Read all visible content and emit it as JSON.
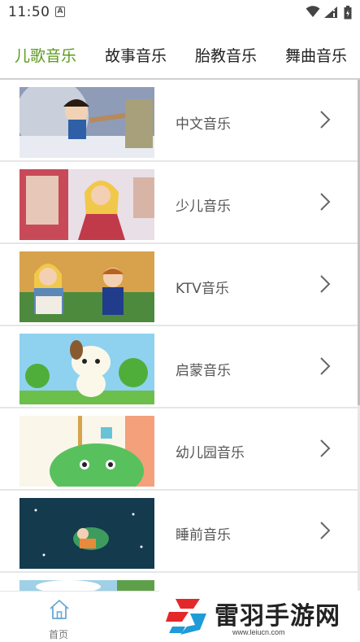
{
  "status_bar": {
    "time": "11:50",
    "notification_glyph": "A"
  },
  "tabs": [
    {
      "label": "儿歌音乐",
      "active": true
    },
    {
      "label": "故事音乐",
      "active": false
    },
    {
      "label": "胎教音乐",
      "active": false
    },
    {
      "label": "舞曲音乐",
      "active": false
    }
  ],
  "list": [
    {
      "label": "中文音乐",
      "thumb": "snow-white-thumbnail"
    },
    {
      "label": "少儿音乐",
      "thumb": "princess-thumbnail"
    },
    {
      "label": "KTV音乐",
      "thumb": "prince-princess-thumbnail"
    },
    {
      "label": "启蒙音乐",
      "thumb": "puppy-thumbnail"
    },
    {
      "label": "幼儿园音乐",
      "thumb": "green-monster-thumbnail"
    },
    {
      "label": "睡前音乐",
      "thumb": "moon-girl-thumbnail"
    }
  ],
  "bottom_nav": {
    "home_label": "首页"
  },
  "watermark": {
    "text": "雷羽手游网",
    "url": "www.leiucn.com"
  },
  "colors": {
    "accent": "#5a9a1c",
    "divider": "#e6e6e6"
  }
}
